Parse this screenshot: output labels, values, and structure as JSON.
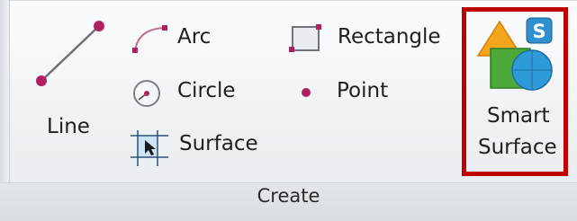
{
  "group": {
    "label": "Create"
  },
  "buttons": {
    "line": {
      "label": "Line"
    },
    "arc": {
      "label": "Arc"
    },
    "circle": {
      "label": "Circle"
    },
    "surface": {
      "label": "Surface"
    },
    "rectangle": {
      "label": "Rectangle"
    },
    "point": {
      "label": "Point"
    },
    "smart_surface": {
      "label_line1": "Smart",
      "label_line2": "Surface",
      "badge": "S"
    }
  },
  "colors": {
    "accent_magenta": "#b0205e",
    "highlight_border": "#c00000",
    "shape_orange": "#f3a51b",
    "shape_green": "#4caa3a",
    "shape_blue": "#2f9ad8"
  }
}
